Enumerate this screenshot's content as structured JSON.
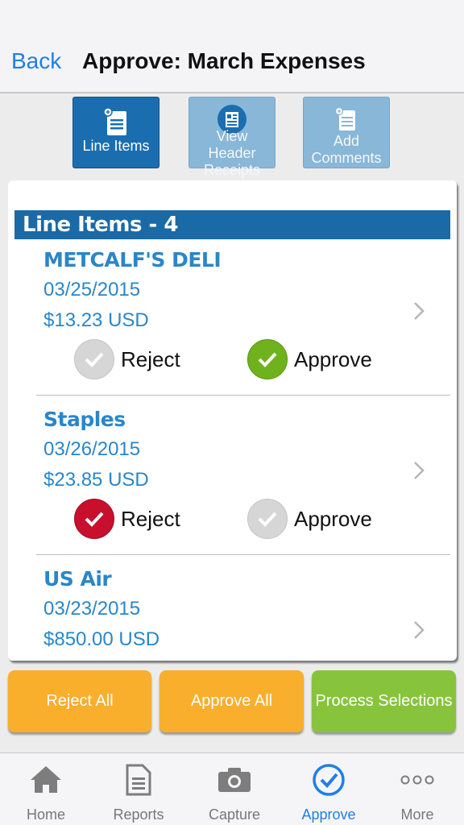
{
  "nav": {
    "back_label": "Back",
    "title": "Approve: March Expenses"
  },
  "segments": [
    {
      "label": "Line Items",
      "icon": "document-add-icon",
      "active": true
    },
    {
      "label": "View Header Receipts",
      "icon": "receipt-icon",
      "active": false
    },
    {
      "label": "Add Comments",
      "icon": "comment-add-icon",
      "active": false
    }
  ],
  "section": {
    "header": "Line Items - 4"
  },
  "items": [
    {
      "name": "METCALF'S DELI",
      "date": "03/25/2015",
      "amount": "$13.23 USD",
      "decision": "approve"
    },
    {
      "name": "Staples",
      "date": "03/26/2015",
      "amount": "$23.85 USD",
      "decision": "reject"
    },
    {
      "name": "US Air",
      "date": "03/23/2015",
      "amount": "$850.00 USD",
      "decision": "none"
    }
  ],
  "choices": {
    "reject_label": "Reject",
    "approve_label": "Approve"
  },
  "actions": {
    "reject_all": "Reject All",
    "approve_all": "Approve All",
    "process": "Process Selections"
  },
  "tabbar": [
    {
      "label": "Home",
      "icon": "home-icon"
    },
    {
      "label": "Reports",
      "icon": "reports-icon"
    },
    {
      "label": "Capture",
      "icon": "camera-icon"
    },
    {
      "label": "Approve",
      "icon": "approve-check-icon",
      "active": true
    },
    {
      "label": "More",
      "icon": "more-dots-icon"
    }
  ],
  "colors": {
    "accent": "#1f7fe6",
    "header_blue": "#1a6aa8",
    "orange": "#f9ae2c",
    "green": "#87c43c",
    "reject_red": "#c8102e",
    "approve_green": "#6fb21d"
  }
}
